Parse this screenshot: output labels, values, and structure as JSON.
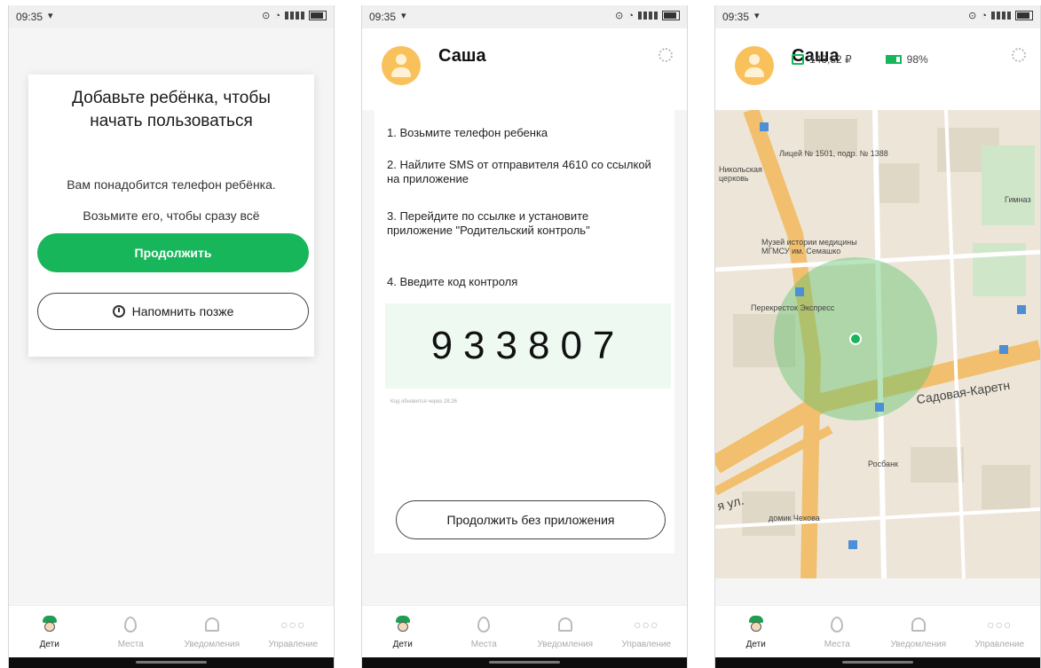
{
  "status": {
    "time": "09:35"
  },
  "tabs": [
    {
      "label": "Дети",
      "icon": "kid-icon",
      "active": true
    },
    {
      "label": "Места",
      "icon": "pin-icon",
      "active": false
    },
    {
      "label": "Уведомления",
      "icon": "bell-icon",
      "active": false
    },
    {
      "label": "Управление",
      "icon": "dots-icon",
      "active": false
    }
  ],
  "screen1": {
    "title": "Добавьте ребёнка, чтобы начать пользоваться",
    "desc1": "Вам понадобится телефон ребёнка.",
    "desc2": "Возьмите его, чтобы сразу всё настроить.",
    "continue_label": "Продолжить",
    "remind_label": "Напомнить позже",
    "accent": "#17b65a"
  },
  "screen2": {
    "child_name": "Саша",
    "steps": [
      "1. Возьмите телефон ребенка",
      "2. Найлите SMS от отправителя 4610 со ссылкой на приложение",
      "3. Перейдите по ссылке и установите приложение \"Родительский контроль\"",
      "4. Введите код контроля"
    ],
    "code": "933807",
    "code_hint": "Код обновится через 28:26",
    "skip_label": "Продолжить без приложения"
  },
  "screen3": {
    "child_name": "Саша",
    "balance": "143,52 ₽",
    "battery": "98%",
    "map_labels": {
      "street": "Садовая-Каретн",
      "street_left": "я ул.",
      "school": "Лицей № 1501, подр. № 1388",
      "museum": "Музей истории медицины МГМСУ им. Семашко",
      "store": "Перекресток Экспресс",
      "bank": "Росбанк",
      "house": "домик Чехова",
      "church": "Никольская церковь",
      "gym": "Гимназ"
    }
  }
}
